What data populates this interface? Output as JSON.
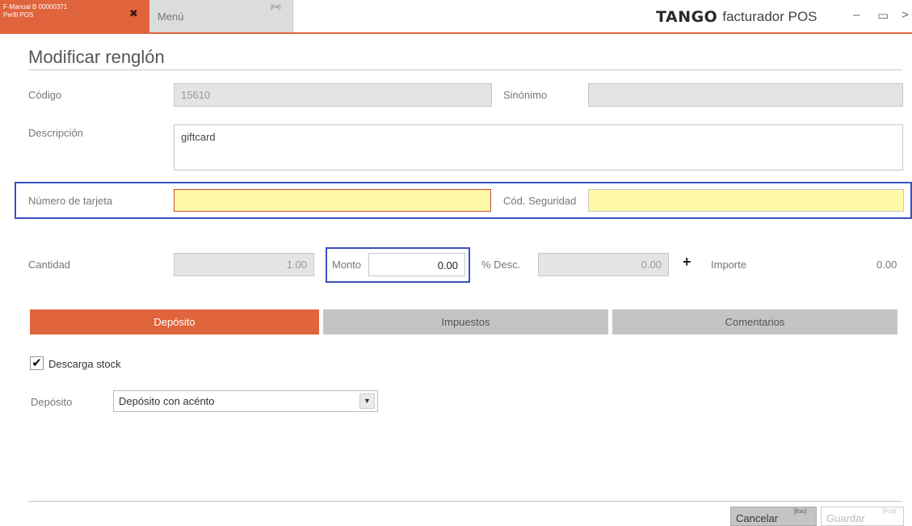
{
  "titlebar": {
    "tab_active_line1": "F-Manual B 00000371",
    "tab_active_line2": "Perfil POS",
    "tab_menu_label": "Menú",
    "tab_menu_key": "[F4]",
    "brand_logo": "TANGO",
    "brand_app": "facturador POS",
    "minimize": "–",
    "maximize": "▭",
    "close": ">"
  },
  "form": {
    "title": "Modificar renglón",
    "codigo_label": "Código",
    "codigo_value": "15610",
    "sinonimo_label": "Sinónimo",
    "sinonimo_value": "",
    "descripcion_label": "Descripción",
    "descripcion_value": "giftcard",
    "tarjeta_label": "Número de tarjeta",
    "tarjeta_value": "",
    "seguridad_label": "Cód. Seguridad",
    "seguridad_value": "",
    "cantidad_label": "Cantidad",
    "cantidad_value": "1.00",
    "monto_label": "Monto",
    "monto_value": "0.00",
    "desc_label": "% Desc.",
    "desc_value": "0.00",
    "plus": "+",
    "importe_label": "Importe",
    "importe_value": "0.00"
  },
  "tabs": [
    {
      "label": "Depósito",
      "active": true
    },
    {
      "label": "Impuestos",
      "active": false
    },
    {
      "label": "Comentarios",
      "active": false
    }
  ],
  "deposito": {
    "descarga_label": "Descarga stock",
    "descarga_checked": true,
    "checkmark": "✔",
    "deposito_label": "Depósito",
    "deposito_value": "Depósito con acénto"
  },
  "footer": {
    "cancel_label": "Cancelar",
    "cancel_key": "[Esc]",
    "save_label": "Guardar",
    "save_key": "[F10]"
  },
  "colors": {
    "accent": "#e0643c",
    "highlight_box": "#3b4fbf",
    "yellow_field": "#fff8a8"
  }
}
